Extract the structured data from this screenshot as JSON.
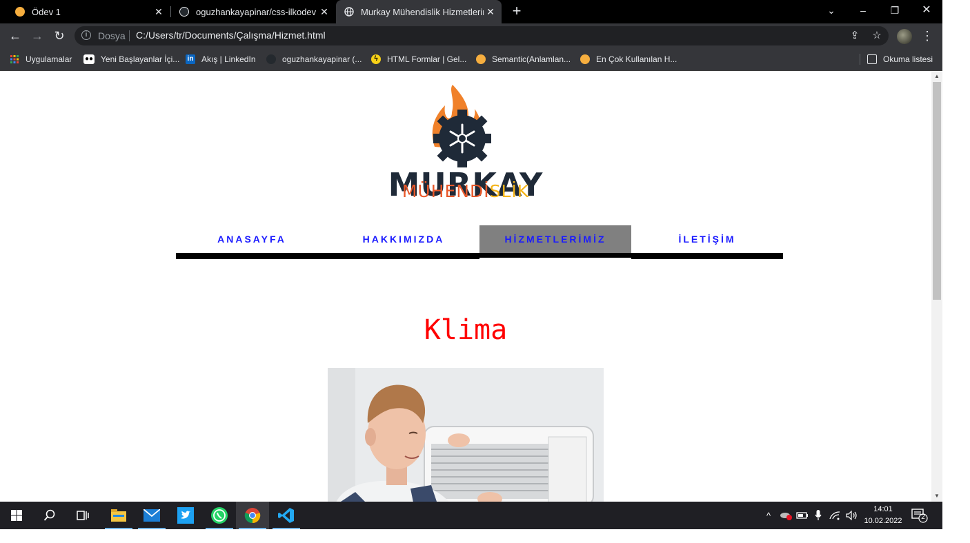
{
  "browser": {
    "tabs": [
      {
        "title": "Ödev 1",
        "favicon": "orange-circle-icon",
        "favicon_color": "#f6ae3f"
      },
      {
        "title": "oguzhankayapinar/css-ilkodev",
        "favicon": "github-icon",
        "favicon_color": "#ffffff"
      },
      {
        "title": "Murkay Mühendislik Hizmetlerim",
        "favicon": "globe-icon",
        "favicon_color": "#ffffff"
      }
    ],
    "address": {
      "scheme_label": "Dosya",
      "url": "C:/Users/tr/Documents/Çalışma/Hizmet.html"
    },
    "bookmarks": [
      {
        "label": "Uygulamalar",
        "icon": "apps-grid-icon"
      },
      {
        "label": "Yeni Başlayanlar İçi...",
        "icon": "medium-icon"
      },
      {
        "label": "Akış | LinkedIn",
        "icon": "linkedin-icon"
      },
      {
        "label": "oguzhankayapinar (...",
        "icon": "github-icon"
      },
      {
        "label": "HTML Formlar | Gel...",
        "icon": "bolt-icon"
      },
      {
        "label": "Semantic(Anlamlan...",
        "icon": "orange-circle-icon"
      },
      {
        "label": "En Çok Kullanılan H...",
        "icon": "orange-circle-icon"
      }
    ],
    "reading_list": "Okuma listesi"
  },
  "page": {
    "logo": {
      "line1": "MURKAY",
      "line2_orange": "MÜHENDİ",
      "line2_yellow": "SLİK"
    },
    "nav": [
      {
        "label": "ANASAYFA"
      },
      {
        "label": "HAKKIMIZDA"
      },
      {
        "label": "HİZMETLERİMİZ",
        "active": true
      },
      {
        "label": "İLETİŞİM"
      }
    ],
    "section_title": "Klima",
    "colors": {
      "nav_link": "#1a1aff",
      "nav_active_bg": "#808080",
      "title": "#ff0000"
    }
  },
  "taskbar": {
    "apps": [
      "file-explorer-icon",
      "mail-icon",
      "twitter-icon",
      "whatsapp-icon",
      "chrome-icon",
      "vscode-icon"
    ],
    "clock_time": "14:01",
    "clock_date": "10.02.2022",
    "notification_count": "2"
  }
}
